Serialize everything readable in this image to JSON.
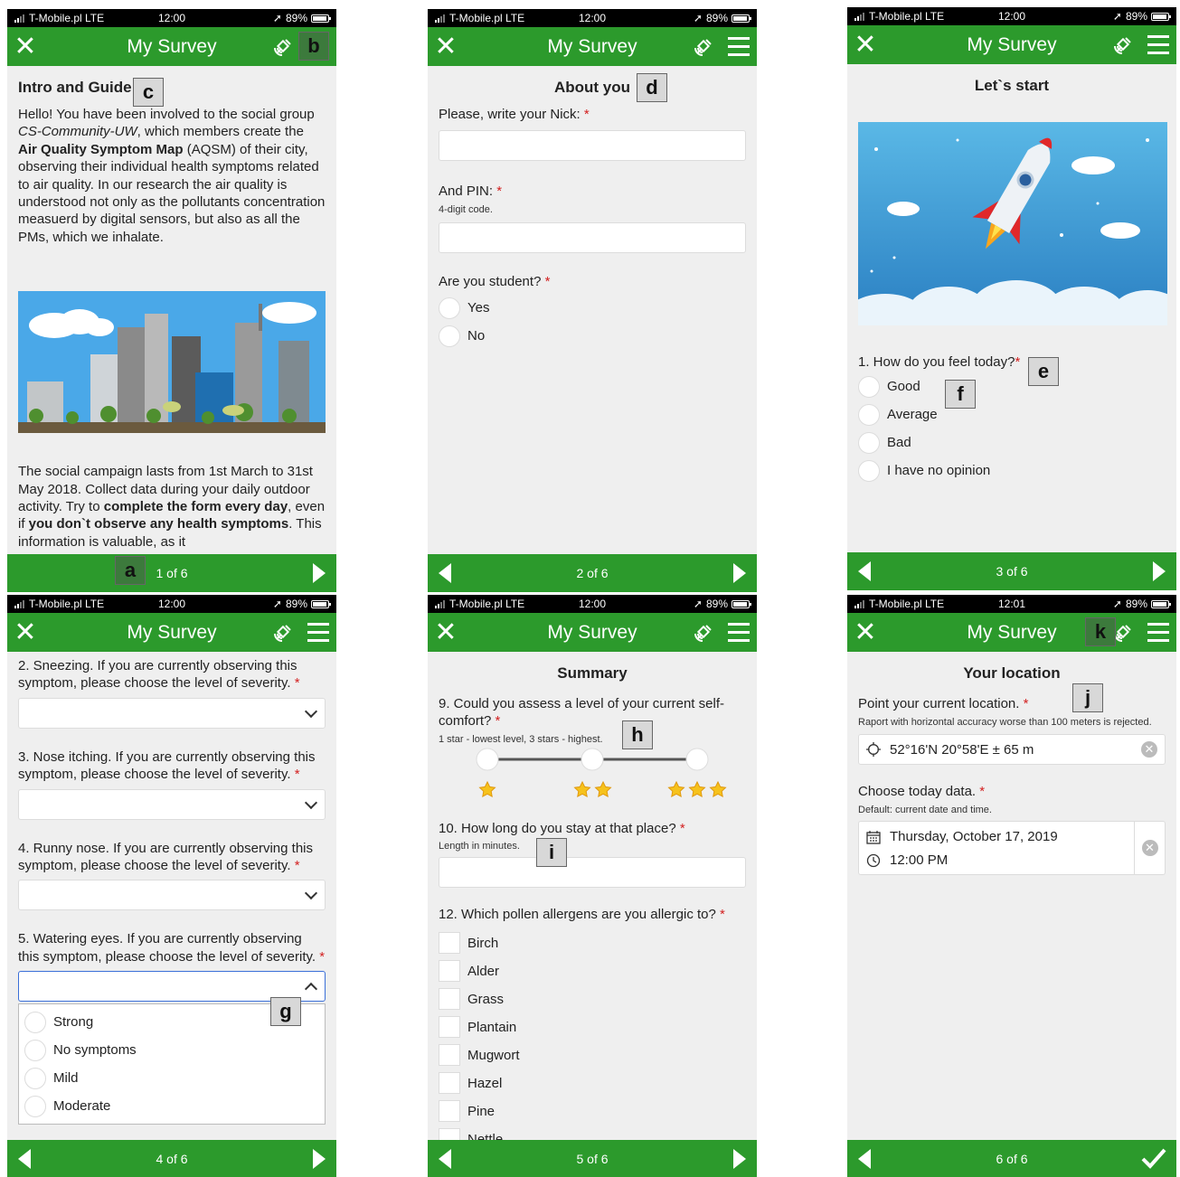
{
  "status": {
    "carrier": "T-Mobile.pl LTE",
    "battery": "89%",
    "time": "12:00",
    "time6": "12:01"
  },
  "app": {
    "title": "My Survey"
  },
  "labels": {
    "a": "a",
    "b": "b",
    "c": "c",
    "d": "d",
    "e": "e",
    "f": "f",
    "g": "g",
    "h": "h",
    "i": "i",
    "j": "j",
    "k": "k"
  },
  "screen1": {
    "heading": "Intro and Guide",
    "p1_a": "Hello! You have been involved to the social group ",
    "p1_group": "CS-Community-UW",
    "p1_b": ", which members create the ",
    "p1_map": "Air Quality Symptom Map",
    "p1_c": " (AQSM) of their city, observing their individual health symptoms related to air quality. In our research the air quality is understood not only as the pollutants concentration measuerd by digital sensors, but also as all the PMs, which we inhalate.",
    "p2_a": "The social campaign lasts from 1st March to 31st May 2018. Collect data during your daily outdoor activity. Try to ",
    "p2_bold1": "complete the form every day",
    "p2_b": ", even if ",
    "p2_bold2": "you don`t observe any health symptoms",
    "p2_c": ". This information is valuable, as it",
    "footer": "1 of 6"
  },
  "screen2": {
    "heading": "About you",
    "q_nick": "Please, write your Nick:",
    "q_pin": "And PIN:",
    "pin_hint": "4-digit code.",
    "q_student": "Are you student?",
    "opt_yes": "Yes",
    "opt_no": "No",
    "footer": "2 of 6"
  },
  "screen3": {
    "heading": "Let`s start",
    "q1": "1. How do you feel today?",
    "options": [
      "Good",
      "Average",
      "Bad",
      "I have no opinion"
    ],
    "footer": "3 of 6"
  },
  "screen4": {
    "q2": "2. Sneezing. If you are currently observing this symptom, please choose the level of severity.",
    "q3": "3. Nose itching. If you are currently observing this symptom, please choose the level of severity.",
    "q4": "4. Runny nose. If you are currently observing this symptom, please choose the level of severity.",
    "q5": "5. Watering eyes. If you are currently observing this symptom, please choose the level of severity.",
    "dropdown_options": [
      "Strong",
      "No symptoms",
      "Mild",
      "Moderate"
    ],
    "footer": "4 of 6"
  },
  "screen5": {
    "heading": "Summary",
    "q9": "9. Could you assess a level of your current self-comfort?",
    "q9_hint": "1 star - lowest level, 3 stars - highest.",
    "q10": "10. How long do you stay at that place?",
    "q10_hint": "Length in minutes.",
    "q12": "12. Which pollen allergens are you allergic to?",
    "allergens": [
      "Birch",
      "Alder",
      "Grass",
      "Plantain",
      "Mugwort",
      "Hazel",
      "Pine",
      "Nettle"
    ],
    "footer": "5 of 6"
  },
  "screen6": {
    "heading": "Your location",
    "q_loc": "Point your current location.",
    "loc_hint": "Raport with horizontal accuracy worse than 100 meters is rejected.",
    "loc_value": "52°16'N 20°58'E ± 65 m",
    "q_date": "Choose today data.",
    "date_hint": "Default: current date and time.",
    "date_value": "Thursday, October 17, 2019",
    "time_value": "12:00 PM",
    "footer": "6 of 6"
  },
  "colors": {
    "green": "#2c9a2c",
    "required": "#d32020"
  }
}
